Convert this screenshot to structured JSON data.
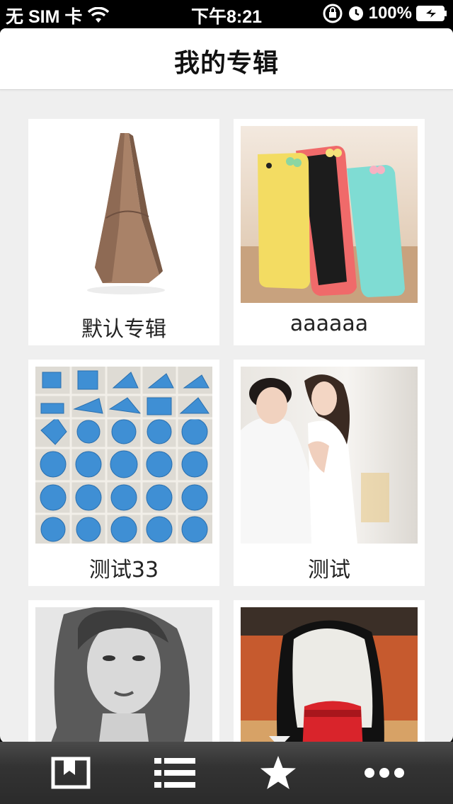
{
  "status_bar": {
    "carrier": "无 SIM 卡",
    "time": "下午8:21",
    "battery": "100%"
  },
  "nav": {
    "title": "我的专辑"
  },
  "albums": [
    {
      "label": "默认专辑",
      "image": "brown-handbag-photo"
    },
    {
      "label": "aaaaaa",
      "image": "colorful-phone-cases-photo"
    },
    {
      "label": "测试33",
      "image": "origami-rose-steps-photo"
    },
    {
      "label": "测试",
      "image": "couple-portrait-photo"
    },
    {
      "label": "",
      "image": "woman-portrait-bw-photo"
    },
    {
      "label": "",
      "image": "backpack-photo"
    }
  ],
  "tabbar": {
    "items": [
      {
        "icon": "bookmark-icon"
      },
      {
        "icon": "list-icon"
      },
      {
        "icon": "star-icon",
        "active": true
      },
      {
        "icon": "more-icon"
      }
    ]
  },
  "colors": {
    "background": "#efefef",
    "tabbar": "#333333",
    "card": "#ffffff"
  }
}
